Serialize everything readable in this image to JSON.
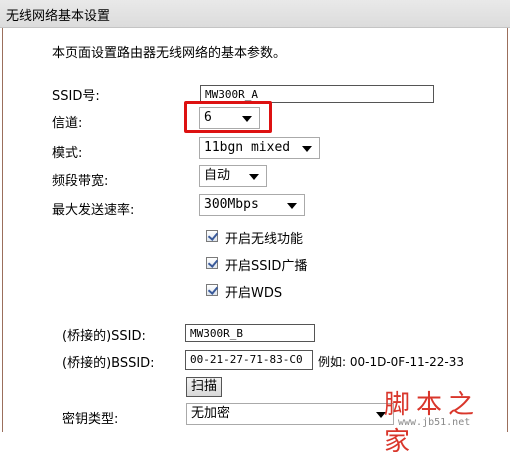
{
  "header": {
    "title": "无线网络基本设置"
  },
  "description": "本页面设置路由器无线网络的基本参数。",
  "fields": {
    "ssid": {
      "label": "SSID号:",
      "value": "MW300R_A"
    },
    "channel": {
      "label": "信道:",
      "value": "6"
    },
    "mode": {
      "label": "模式:",
      "value": "11bgn mixed"
    },
    "bandwidth": {
      "label": "频段带宽:",
      "value": "自动"
    },
    "max_rate": {
      "label": "最大发送速率:",
      "value": "300Mbps"
    }
  },
  "checkboxes": [
    {
      "label": "开启无线功能",
      "checked": true
    },
    {
      "label": "开启SSID广播",
      "checked": true
    },
    {
      "label": "开启WDS",
      "checked": true
    }
  ],
  "wds": {
    "bridge_ssid_label": "(桥接的)SSID:",
    "bridge_ssid_value": "MW300R_B",
    "bridge_bssid_label": "(桥接的)BSSID:",
    "bridge_bssid_value": "00-21-27-71-83-C0",
    "example": "例如: 00-1D-0F-11-22-33",
    "scan_label": "扫描"
  },
  "security": {
    "key_type_label": "密钥类型:",
    "key_type_value": "无加密"
  },
  "watermark": {
    "logo": "脚本之家",
    "url": "www.jb51.net"
  },
  "colors": {
    "highlight": "#dd1111",
    "panel_border": "#9b6f5c",
    "watermark": "#d9362b"
  }
}
